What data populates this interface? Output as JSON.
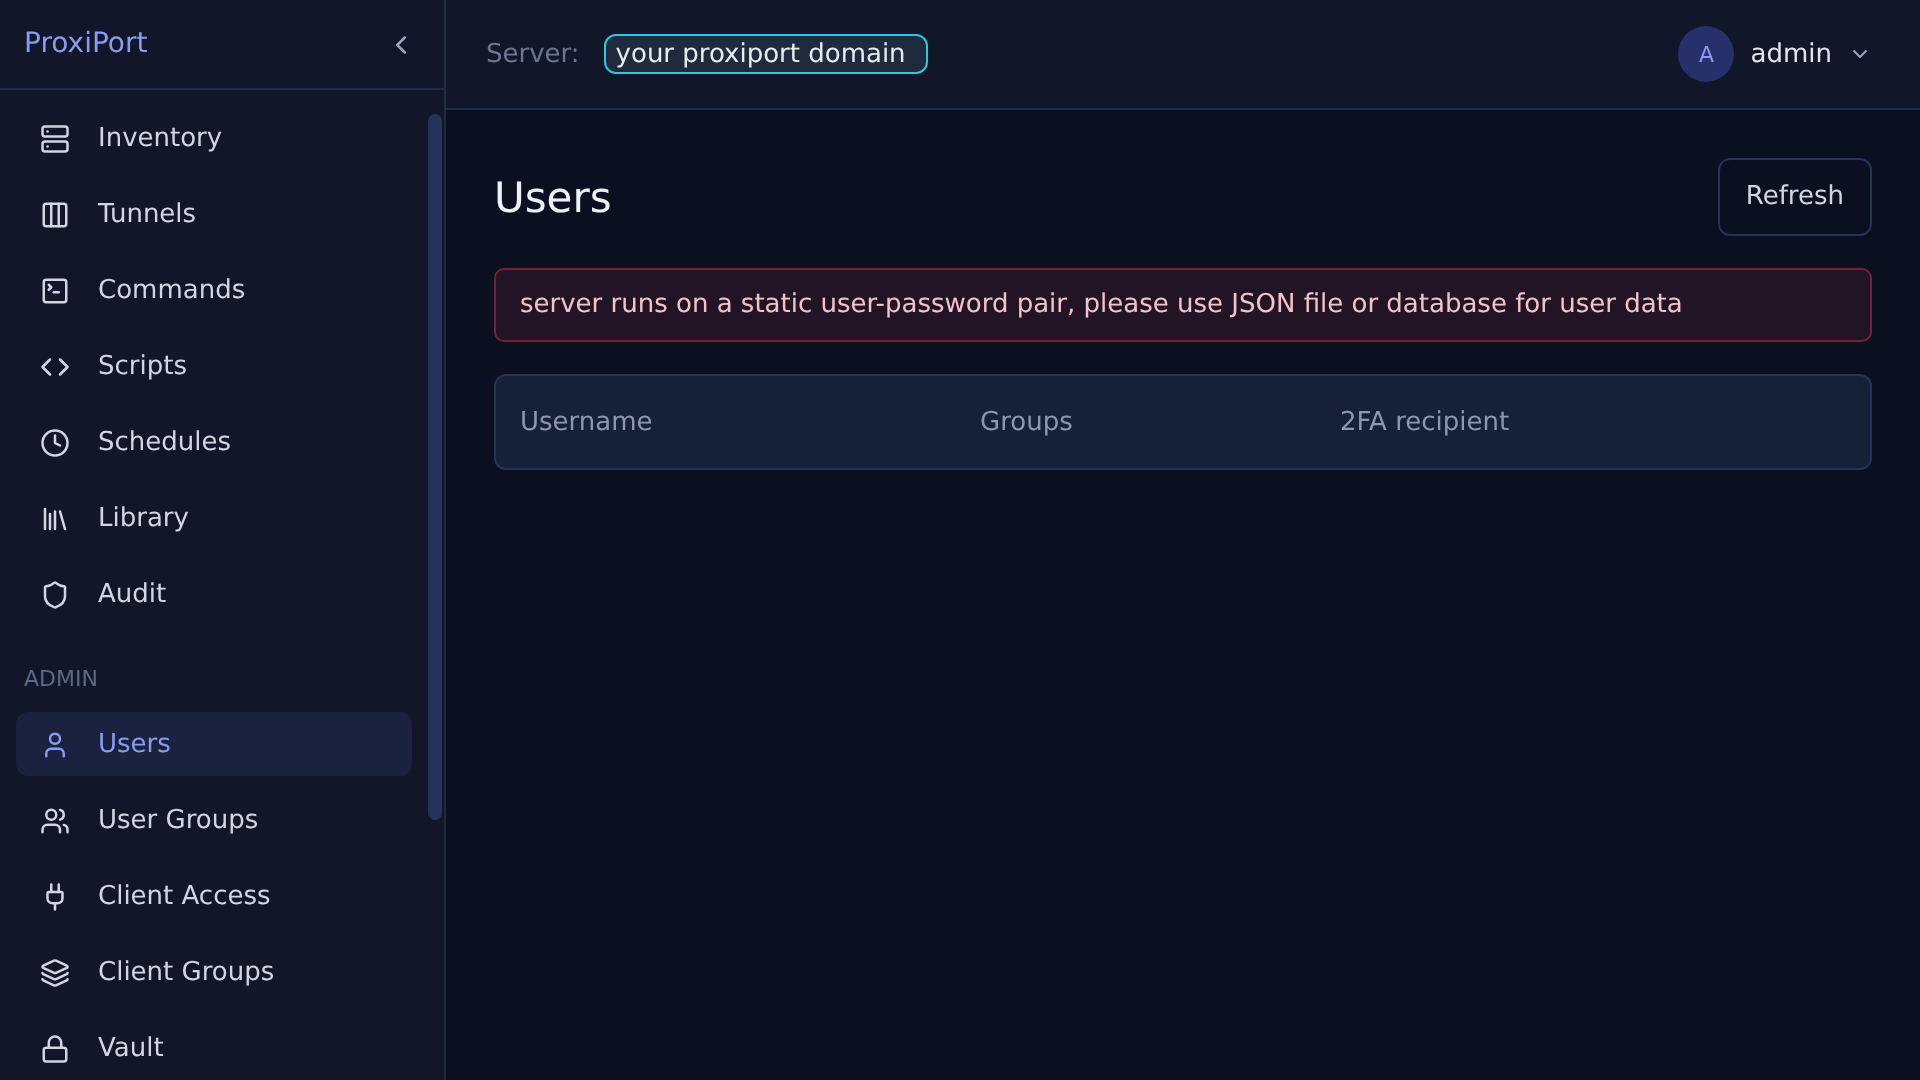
{
  "brand": "ProxiPort",
  "topbar": {
    "server_label": "Server:",
    "server_value": "your proxiport domain",
    "user_initial": "A",
    "user_name": "admin"
  },
  "sidebar": {
    "items": [
      {
        "label": "Inventory",
        "selected": false
      },
      {
        "label": "Tunnels",
        "selected": false
      },
      {
        "label": "Commands",
        "selected": false
      },
      {
        "label": "Scripts",
        "selected": false
      },
      {
        "label": "Schedules",
        "selected": false
      },
      {
        "label": "Library",
        "selected": false
      },
      {
        "label": "Audit",
        "selected": false
      }
    ],
    "section": "ADMIN",
    "admin_items": [
      {
        "label": "Users",
        "selected": true
      },
      {
        "label": "User Groups",
        "selected": false
      },
      {
        "label": "Client Access",
        "selected": false
      },
      {
        "label": "Client Groups",
        "selected": false
      },
      {
        "label": "Vault",
        "selected": false
      }
    ]
  },
  "page": {
    "title": "Users",
    "refresh": "Refresh",
    "alert": "server runs on a static user-password pair, please use JSON file or database for user data",
    "table": {
      "columns": [
        "Username",
        "Groups",
        "2FA recipient"
      ]
    }
  }
}
